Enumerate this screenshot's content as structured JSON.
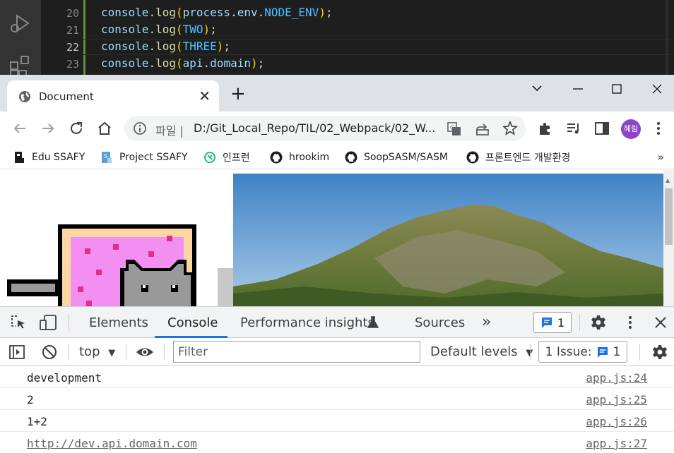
{
  "editor": {
    "line_numbers": [
      "20",
      "21",
      "22",
      "23"
    ],
    "active_line": "22",
    "lines": [
      {
        "obj": "console",
        "fn": "log",
        "args": [
          {
            "t": "process",
            "c": "id"
          },
          {
            "t": ".",
            "c": "dot"
          },
          {
            "t": "env",
            "c": "id"
          },
          {
            "t": ".",
            "c": "dot"
          },
          {
            "t": "NODE_ENV",
            "c": "const"
          }
        ]
      },
      {
        "obj": "console",
        "fn": "log",
        "args": [
          {
            "t": "TWO",
            "c": "const"
          }
        ]
      },
      {
        "obj": "console",
        "fn": "log",
        "args": [
          {
            "t": "THREE",
            "c": "const"
          }
        ]
      },
      {
        "obj": "console",
        "fn": "log",
        "args": [
          {
            "t": "api",
            "c": "id"
          },
          {
            "t": ".",
            "c": "dot"
          },
          {
            "t": "domain",
            "c": "id"
          }
        ]
      }
    ]
  },
  "browser": {
    "tab_title": "Document",
    "new_tab_symbol": "+",
    "close_symbol": "✕",
    "omnibox_label": "파일 |",
    "url": "D:/Git_Local_Repo/TIL/02_Webpack/02_W...",
    "profile_label": "혜림",
    "bookmarks": [
      {
        "label": "Edu SSAFY",
        "icon": "edu-ssafy-icon"
      },
      {
        "label": "Project SSAFY",
        "icon": "project-ssafy-icon"
      },
      {
        "label": "인프런",
        "icon": "inflearn-icon"
      },
      {
        "label": "hrookim",
        "icon": "github-icon"
      },
      {
        "label": "SoopSASM/SASM",
        "icon": "github-icon"
      },
      {
        "label": "프론트엔드 개발환경",
        "icon": "github-icon"
      }
    ],
    "bookmarks_more": "»"
  },
  "devtools": {
    "tabs": [
      "Elements",
      "Console",
      "Performance insights",
      "Sources"
    ],
    "active_tab": "Console",
    "more_tabs": "»",
    "message_count": "1",
    "context": "top",
    "filter_placeholder": "Filter",
    "levels": "Default levels",
    "issues_label": "1 Issue:",
    "issues_count": "1",
    "rows": [
      {
        "message": "development",
        "source": "app.js:24",
        "link": false
      },
      {
        "message": "2",
        "source": "app.js:25",
        "link": false
      },
      {
        "message": "1+2",
        "source": "app.js:26",
        "link": false
      },
      {
        "message": "http://dev.api.domain.com",
        "source": "app.js:27",
        "link": true
      }
    ]
  },
  "colors": {
    "accent": "#1a73e8",
    "editor_bg": "#1e1e1e",
    "tab_bar": "#dee1e6",
    "profile": "#8e44c9"
  }
}
